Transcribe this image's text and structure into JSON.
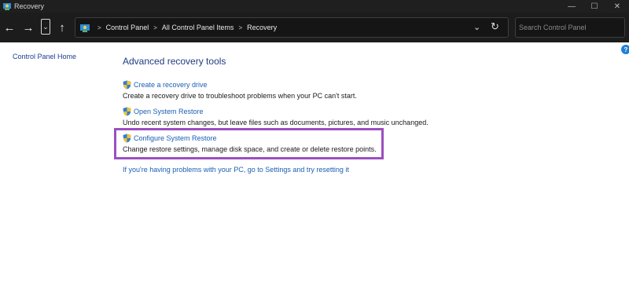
{
  "window": {
    "title": "Recovery",
    "minimize_glyph": "—",
    "maximize_glyph": "☐",
    "close_glyph": "✕"
  },
  "nav": {
    "back_glyph": "←",
    "forward_glyph": "→",
    "recent_glyph": "⌄",
    "up_glyph": "↑"
  },
  "address": {
    "breadcrumbs": [
      "Control Panel",
      "All Control Panel Items",
      "Recovery"
    ],
    "separator": ">",
    "dropdown_glyph": "⌄",
    "refresh_glyph": "↻"
  },
  "search": {
    "placeholder": "Search Control Panel"
  },
  "help": {
    "glyph": "?"
  },
  "left_pane": {
    "home_link": "Control Panel Home"
  },
  "main": {
    "heading": "Advanced recovery tools",
    "tools": [
      {
        "link": "Create a recovery drive",
        "description": "Create a recovery drive to troubleshoot problems when your PC can't start."
      },
      {
        "link": "Open System Restore",
        "description": "Undo recent system changes, but leave files such as documents, pictures, and music unchanged."
      },
      {
        "link": "Configure System Restore",
        "description": "Change restore settings, manage disk space, and create or delete restore points."
      }
    ],
    "reset_link": "If you're having problems with your PC, go to Settings and try resetting it"
  },
  "colors": {
    "highlight": "#9b4fc0",
    "link": "#1a5fb4",
    "heading": "#1e3b80",
    "titlebar": "#1f1f1f"
  }
}
